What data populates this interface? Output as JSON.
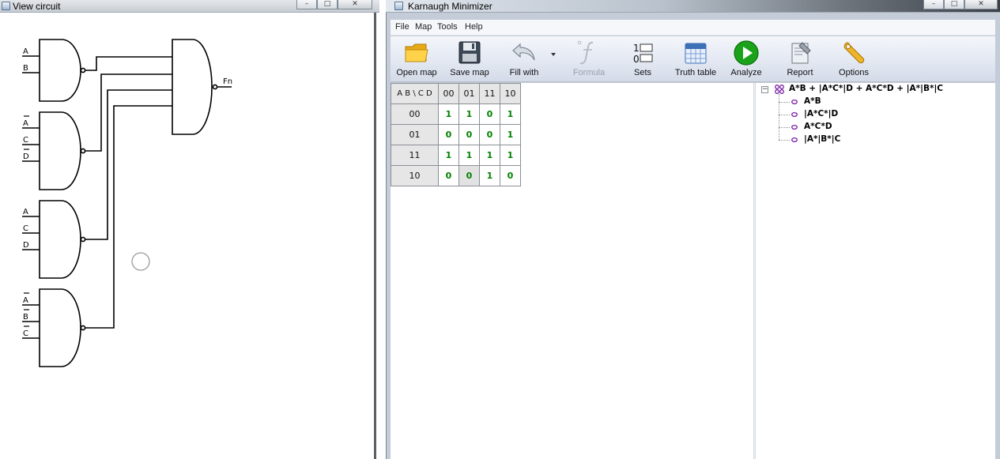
{
  "circuit_window": {
    "title": "View circuit",
    "buttons": {
      "minimize": "–",
      "maximize": "□",
      "close": "✕"
    },
    "gates": [
      {
        "inputs": [
          {
            "label": "A",
            "negated": false
          },
          {
            "label": "B",
            "negated": false
          }
        ]
      },
      {
        "inputs": [
          {
            "label": "A",
            "negated": true
          },
          {
            "label": "C",
            "negated": false
          },
          {
            "label": "D",
            "negated": true
          }
        ]
      },
      {
        "inputs": [
          {
            "label": "A",
            "negated": false
          },
          {
            "label": "C",
            "negated": false
          },
          {
            "label": "D",
            "negated": false
          }
        ]
      },
      {
        "inputs": [
          {
            "label": "A",
            "negated": true
          },
          {
            "label": "B",
            "negated": true
          },
          {
            "label": "C",
            "negated": true
          }
        ]
      }
    ],
    "output_label": "Fn"
  },
  "minimizer_window": {
    "title": "Karnaugh Minimizer",
    "buttons": {
      "minimize": "–",
      "maximize": "□",
      "close": "✕"
    },
    "menu": [
      "File",
      "Map",
      "Tools",
      "Help"
    ],
    "toolbar": [
      {
        "label": "Open map",
        "icon": "folder-icon",
        "enabled": true
      },
      {
        "label": "Save map",
        "icon": "floppy-icon",
        "enabled": true
      },
      {
        "label": "Fill with",
        "icon": "undo-arrow-icon",
        "enabled": true
      },
      {
        "label": "Formula",
        "icon": "function-icon",
        "enabled": false
      },
      {
        "label": "Sets",
        "icon": "sets-icon",
        "enabled": true
      },
      {
        "label": "Truth table",
        "icon": "calendar-table-icon",
        "enabled": true
      },
      {
        "label": "Analyze",
        "icon": "play-icon",
        "enabled": true
      },
      {
        "label": "Report",
        "icon": "report-icon",
        "enabled": true
      },
      {
        "label": "Options",
        "icon": "wrench-icon",
        "enabled": true
      }
    ],
    "sets_icon_digits": [
      "1",
      "0"
    ],
    "kmap": {
      "corner": "A B \\ C D",
      "columns": [
        "00",
        "01",
        "11",
        "10"
      ],
      "rows": [
        {
          "label": "00",
          "cells": [
            "1",
            "1",
            "0",
            "1"
          ]
        },
        {
          "label": "01",
          "cells": [
            "0",
            "0",
            "0",
            "1"
          ]
        },
        {
          "label": "11",
          "cells": [
            "1",
            "1",
            "1",
            "1"
          ]
        },
        {
          "label": "10",
          "cells": [
            "0",
            "0",
            "1",
            "0"
          ]
        }
      ]
    },
    "tree": {
      "expander": "−",
      "root": "A*B + |A*C*|D + A*C*D + |A*|B*|C",
      "children": [
        "A*B",
        "|A*C*|D",
        "A*C*D",
        "|A*|B*|C"
      ]
    }
  },
  "colors": {
    "kmap_value": "#008000",
    "tree_icon": "#7b1fa2",
    "analyze_green": "#1aa31a"
  }
}
